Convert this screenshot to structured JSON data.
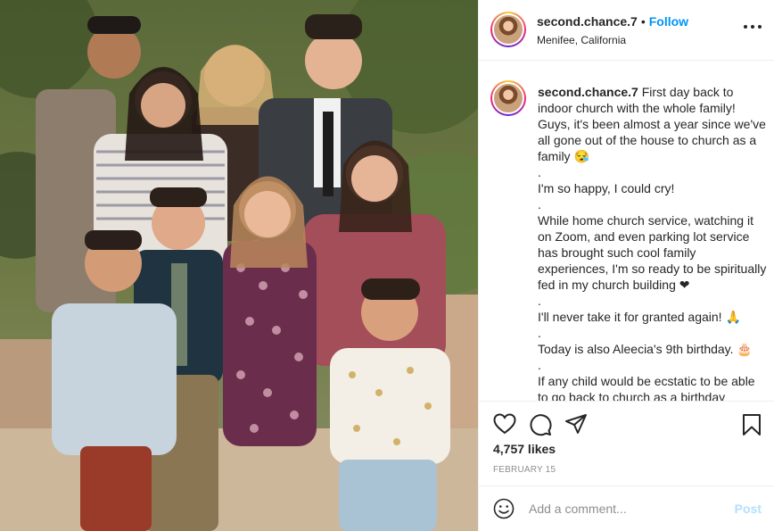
{
  "post": {
    "username": "second.chance.7",
    "follow_label": "Follow",
    "separator": "•",
    "location": "Menifee, California",
    "caption_lines": [
      "First day back to indoor church with the whole family! Guys, it's been almost a year since we've all gone out of the house to church as a family 😪",
      ".",
      "I'm so happy, I could cry!",
      ".",
      "While home church service, watching it on Zoom, and even parking lot service has brought such cool family experiences, I'm so ready to be spiritually fed in my church building ❤",
      ".",
      "I'll never take it for granted again! 🙏",
      ".",
      "Today is also Aleecia's 9th birthday. 🎂",
      ".",
      "If any child would be ecstatic to be able to go back to church as a birthday"
    ],
    "likes": "4,757 likes",
    "date": "FEBRUARY 15"
  },
  "comment": {
    "placeholder": "Add a comment...",
    "post_label": "Post"
  },
  "icons": {
    "like": "heart-icon",
    "comment": "comment-icon",
    "share": "share-icon",
    "save": "bookmark-icon",
    "emoji": "emoji-icon",
    "more": "more-options-icon"
  },
  "colors": {
    "follow": "#0095f6",
    "post_disabled": "#b2dffc",
    "muted": "#8e8e8e"
  }
}
